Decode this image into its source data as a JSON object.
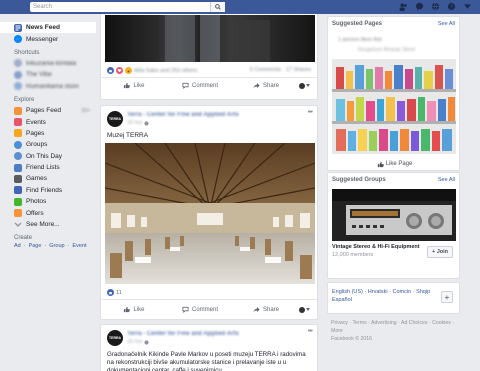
{
  "topbar": {
    "search_placeholder": "Search",
    "icons": [
      "friend-requests-icon",
      "messages-icon",
      "globe-icon",
      "help-icon",
      "dropdown-arrow-icon"
    ]
  },
  "leftnav": {
    "primary": [
      {
        "label": "News Feed",
        "icon": "news-feed-icon",
        "active": true
      },
      {
        "label": "Messenger",
        "icon": "messenger-icon",
        "active": false
      }
    ],
    "shortcuts_heading": "Shortcuts",
    "shortcuts": [
      {
        "label": "Inkuzania kimtala",
        "color": "#8b9dc3"
      },
      {
        "label": "The Vibe",
        "color": "#6e8cc1"
      },
      {
        "label": "Humanitama stom",
        "color": "#7ba0d1"
      }
    ],
    "explore_heading": "Explore",
    "explore": [
      {
        "label": "Pages Feed",
        "icon": "pages-feed-icon",
        "color": "#f7923a",
        "badge": "20+"
      },
      {
        "label": "Events",
        "icon": "events-icon",
        "color": "#e9546b"
      },
      {
        "label": "Pages",
        "icon": "pages-icon",
        "color": "#f5a623"
      },
      {
        "label": "Groups",
        "icon": "groups-icon",
        "color": "#4a90d9"
      },
      {
        "label": "On This Day",
        "icon": "on-this-day-icon",
        "color": "#5b8fd1"
      },
      {
        "label": "Friend Lists",
        "icon": "friend-lists-icon",
        "color": "#4d7cc7"
      },
      {
        "label": "Games",
        "icon": "games-icon",
        "color": "#5a5a5a"
      },
      {
        "label": "Find Friends",
        "icon": "find-friends-icon",
        "color": "#4267b2"
      },
      {
        "label": "Photos",
        "icon": "photos-icon",
        "color": "#42b72a"
      },
      {
        "label": "Offers",
        "icon": "offers-icon",
        "color": "#f7923a"
      },
      {
        "label": "See More...",
        "icon": "see-more-icon",
        "color": "#bec3c9"
      }
    ],
    "create_heading": "Create",
    "create_links": [
      "Ad",
      "Page",
      "Group",
      "Event"
    ]
  },
  "post1": {
    "reactions": "Alila Sabo and 253 others",
    "comments": "5 Comments · 17 Shares",
    "like": "Like",
    "comment": "Comment",
    "share": "Share"
  },
  "post2": {
    "page_name": "Terra - Center for Fine and Applied Arts",
    "time": "15 hrs",
    "text": "Muzej TERRA",
    "reaction_count": "11",
    "like": "Like",
    "comment": "Comment",
    "share": "Share",
    "avatar_text": "TERRA"
  },
  "post3": {
    "page_name": "Terra - Center for Fine and Applied Arts",
    "time": "15 hrs",
    "text": "Gradonačelnik Kikinde Pavle Markov u poseti muzeju TERRA i radovima na rekonstrukciji bivše akumulatorske stanice i prelavanje iste u u dokumentacioni centar, caffe i suvenirnicu.",
    "avatar_text": "TERRA"
  },
  "suggested_pages": {
    "heading": "Suggested Pages",
    "see_all": "See All",
    "subtitle": "1 person likes this",
    "line2": "Drugstore Beauty Store",
    "like_button": "Like Page"
  },
  "suggested_groups": {
    "heading": "Suggested Groups",
    "see_all": "See All",
    "group_name": "Vintage Stereo & Hi-Fi Equipment",
    "members": "12,000 members",
    "join": "+ Join"
  },
  "languages": {
    "items": [
      "English (US)",
      "Hrvatski",
      "Comcin",
      "Shqip",
      "Español"
    ],
    "add_label": "+"
  },
  "footer": {
    "links": [
      "Privacy",
      "Terms",
      "Advertising",
      "Ad Choices",
      "Cookies",
      "More"
    ],
    "copyright": "Facebook © 2016"
  }
}
